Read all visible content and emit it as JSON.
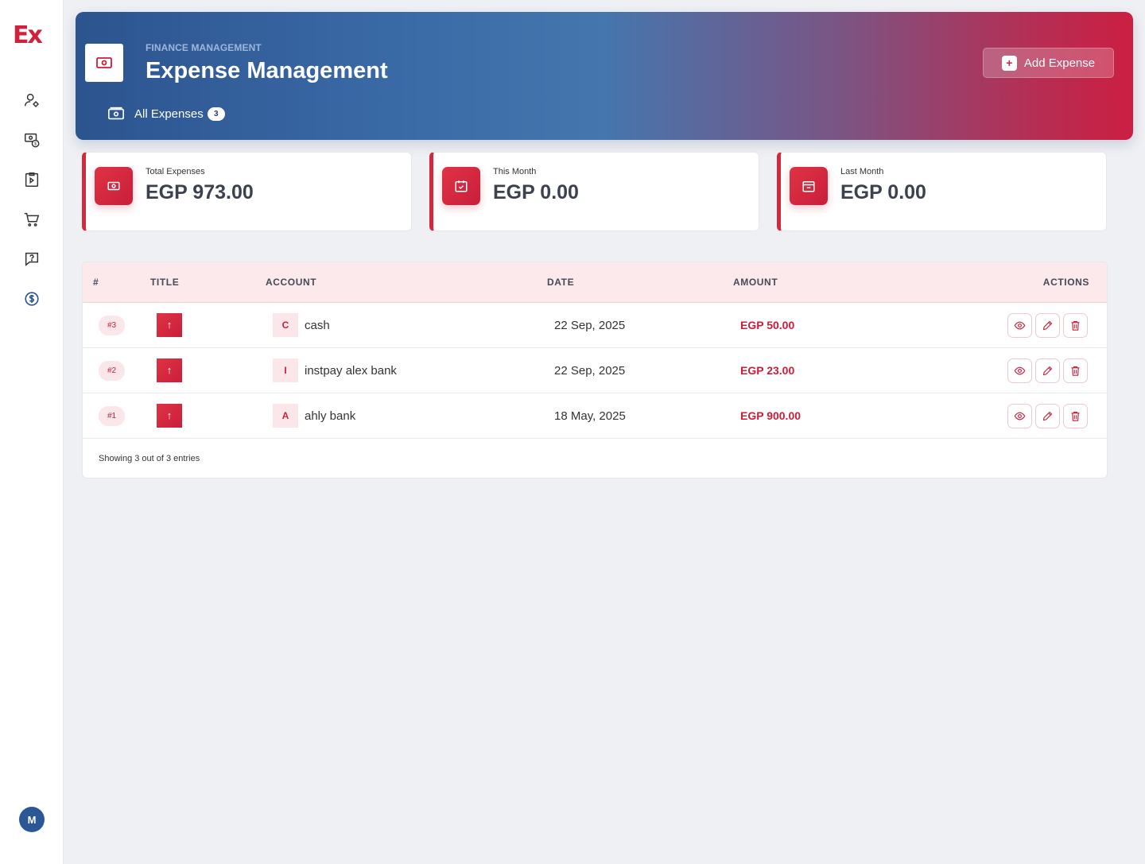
{
  "sidebar": {
    "logo": "Ex",
    "nav": [
      {
        "icon": "user-settings-icon"
      },
      {
        "icon": "money-exchange-icon"
      },
      {
        "icon": "clipboard-icon"
      },
      {
        "icon": "cart-icon"
      },
      {
        "icon": "help-message-icon"
      },
      {
        "icon": "dollar-circle-icon"
      }
    ],
    "avatar_initial": "M"
  },
  "header": {
    "subtitle": "FINANCE MANAGEMENT",
    "title": "Expense Management",
    "tab_label": "All Expenses",
    "tab_count": "3",
    "add_button": "Add Expense"
  },
  "stats": [
    {
      "label": "Total Expenses",
      "value": "EGP 973.00",
      "icon": "money-icon"
    },
    {
      "label": "This Month",
      "value": "EGP 0.00",
      "icon": "calendar-check-icon"
    },
    {
      "label": "Last Month",
      "value": "EGP 0.00",
      "icon": "calendar-minus-icon"
    }
  ],
  "table": {
    "headers": {
      "index": "#",
      "title": "TITLE",
      "account": "ACCOUNT",
      "date": "DATE",
      "amount": "AMOUNT",
      "actions": "ACTIONS"
    },
    "rows": [
      {
        "id": "#3",
        "title_icon": "↑",
        "account_initial": "C",
        "account": "cash",
        "date": "22 Sep, 2025",
        "amount": "EGP 50.00"
      },
      {
        "id": "#2",
        "title_icon": "↑",
        "account_initial": "I",
        "account": "instpay alex bank",
        "date": "22 Sep, 2025",
        "amount": "EGP 23.00"
      },
      {
        "id": "#1",
        "title_icon": "↑",
        "account_initial": "A",
        "account": "ahly bank",
        "date": "18 May, 2025",
        "amount": "EGP 900.00"
      }
    ],
    "footer": "Showing 3 out of 3 entries"
  },
  "colors": {
    "accent": "#c81e3a",
    "banner_start": "#2c548f",
    "banner_end": "#cb1f42",
    "active_nav": "#2c5796"
  }
}
